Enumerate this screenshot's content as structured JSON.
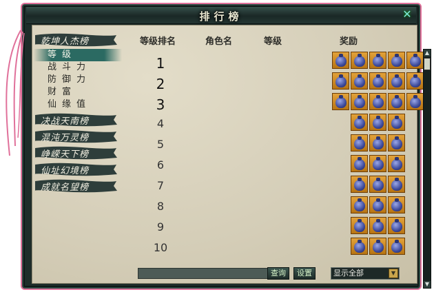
{
  "window": {
    "title": "排行榜"
  },
  "categories": [
    {
      "label": "乾坤人杰榜",
      "expanded": true,
      "items": [
        {
          "label": "等级",
          "selected": true
        },
        {
          "label": "战斗力",
          "selected": false
        },
        {
          "label": "防御力",
          "selected": false
        },
        {
          "label": "财富",
          "selected": false
        },
        {
          "label": "仙缘值",
          "selected": false
        }
      ]
    },
    {
      "label": "决战天南榜"
    },
    {
      "label": "混沌万灵榜"
    },
    {
      "label": "峥嵘天下榜"
    },
    {
      "label": "仙址幻境榜"
    },
    {
      "label": "成就名望榜"
    }
  ],
  "table": {
    "headers": {
      "rank": "等级排名",
      "name": "角色名",
      "level": "等级",
      "reward": "奖励"
    },
    "rows": [
      {
        "rank": "1",
        "reward_count": 5
      },
      {
        "rank": "2",
        "reward_count": 5
      },
      {
        "rank": "3",
        "reward_count": 5
      },
      {
        "rank": "4",
        "reward_count": 3
      },
      {
        "rank": "5",
        "reward_count": 3
      },
      {
        "rank": "6",
        "reward_count": 3
      },
      {
        "rank": "7",
        "reward_count": 3
      },
      {
        "rank": "8",
        "reward_count": 3
      },
      {
        "rank": "9",
        "reward_count": 3
      },
      {
        "rank": "10",
        "reward_count": 3
      }
    ]
  },
  "footer": {
    "query_label": "查询",
    "settings_label": "设置",
    "filter_value": "显示全部"
  },
  "colors": {
    "frame_border": "#e0709a",
    "reward_bag": "#e2a23a",
    "selected_item": "#2b6a62"
  }
}
